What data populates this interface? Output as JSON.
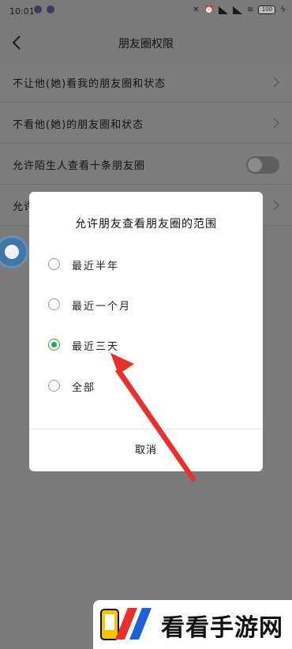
{
  "status_bar": {
    "time": "10:01",
    "battery": "100"
  },
  "nav": {
    "title": "朋友圈权限"
  },
  "settings": {
    "items": [
      {
        "label": "不让他(她)看我的朋友圈和状态",
        "control": "chevron"
      },
      {
        "label": "不看他(她)的朋友圈和状态",
        "control": "chevron"
      },
      {
        "label": "允许陌生人查看十条朋友圈",
        "control": "toggle",
        "enabled": false
      },
      {
        "label": "允许",
        "control": "chevron"
      }
    ]
  },
  "dialog": {
    "title": "允许朋友查看朋友圈的范围",
    "options": [
      {
        "label": "最近半年",
        "selected": false
      },
      {
        "label": "最近一个月",
        "selected": false
      },
      {
        "label": "最近三天",
        "selected": true
      },
      {
        "label": "全部",
        "selected": false
      }
    ],
    "cancel_label": "取消",
    "accent_color": "#23b04a"
  },
  "annotation": {
    "arrow_color": "#e8312c"
  },
  "watermark": {
    "text": "看看手游网"
  }
}
